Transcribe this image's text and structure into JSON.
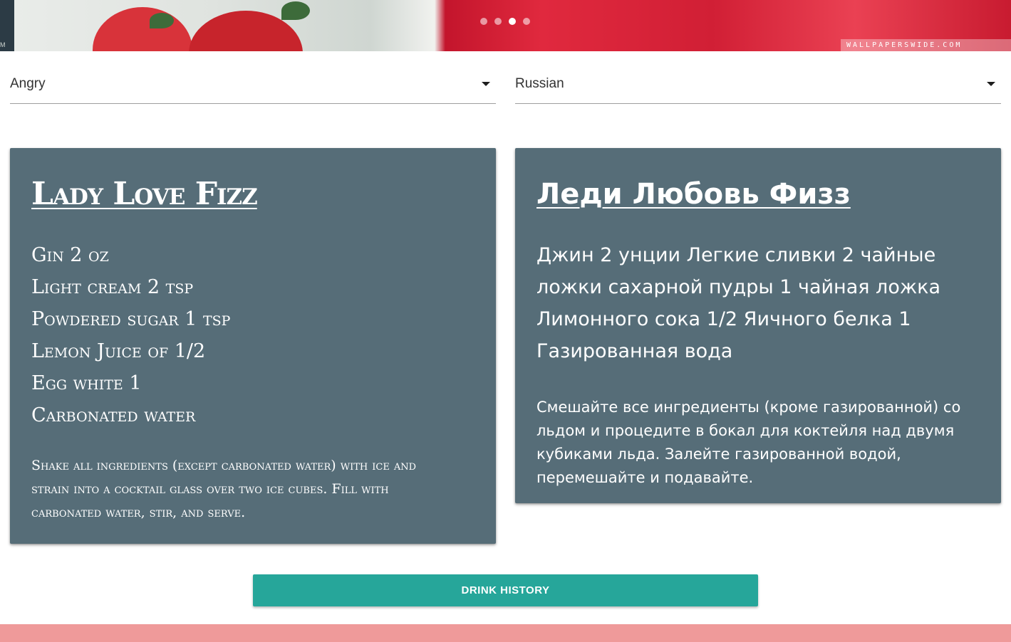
{
  "hero": {
    "watermark": "WALLPAPERSWIDE.COM",
    "corner_text": "M",
    "slides_count": 4,
    "active_slide": 3
  },
  "filters": {
    "mood": {
      "selected": "Angry"
    },
    "language": {
      "selected": "Russian"
    }
  },
  "recipe_original": {
    "title": "Lady Love Fizz",
    "ingredients": [
      "Gin 2 oz",
      "Light cream 2 tsp",
      "Powdered sugar 1 tsp",
      "Lemon Juice of 1/2",
      "Egg white 1",
      "Carbonated water"
    ],
    "instructions": "Shake all ingredients (except carbonated water) with ice and strain into a cocktail glass over two ice cubes. Fill with carbonated water, stir, and serve."
  },
  "recipe_translated": {
    "title": "Леди Любовь Физз",
    "ingredients_text": "Джин 2 унции Легкие сливки 2 чайные ложки сахарной пудры 1 чайная ложка Лимонного сока 1/2 Яичного белка 1 Газированная вода",
    "instructions": "Смешайте все ингредиенты (кроме газированной) со льдом и процедите в бокал для коктейля над двумя кубиками льда. Залейте газированной водой, перемешайте и подавайте."
  },
  "actions": {
    "history_label": "Drink History"
  },
  "colors": {
    "card_bg": "#566d78",
    "button_bg": "#26a69a",
    "footer_bg": "#ef9a9a"
  }
}
